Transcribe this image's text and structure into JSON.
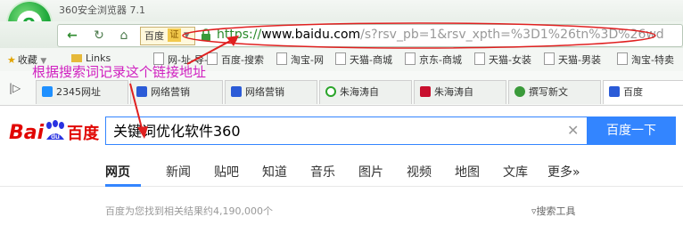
{
  "browser": {
    "title": "360安全浏览器 7.1",
    "engine_label": "百度",
    "cert_label": "证",
    "url_protocol": "https://",
    "url_domain": "www.baidu.com",
    "url_path": "/s?rsv_pb=1&rsv_xpth=%3D1%26tn%3D%26wd"
  },
  "bookmarks": [
    {
      "label": "收藏",
      "icon": "star-icon"
    },
    {
      "label": "Links",
      "icon": "folder-icon"
    },
    {
      "label": "网-址-导-航",
      "icon": "page-icon"
    },
    {
      "label": "百度-搜索",
      "icon": "page-icon"
    },
    {
      "label": "淘宝-网",
      "icon": "page-icon"
    },
    {
      "label": "天猫-商城",
      "icon": "page-icon"
    },
    {
      "label": "京东-商城",
      "icon": "page-icon"
    },
    {
      "label": "天猫-女装",
      "icon": "page-icon"
    },
    {
      "label": "天猫-男装",
      "icon": "page-icon"
    },
    {
      "label": "淘宝-特卖",
      "icon": "page-icon"
    }
  ],
  "tabs": [
    {
      "label": "2345网址",
      "color": "#1e90ff"
    },
    {
      "label": "网络营销",
      "color": "#2b5bd7"
    },
    {
      "label": "网络营销",
      "color": "#2b5bd7"
    },
    {
      "label": "朱海涛自",
      "color": "#2aa52a"
    },
    {
      "label": "朱海涛自",
      "color": "#c8102e"
    },
    {
      "label": "撰写新文",
      "color": "#3a9a3a"
    },
    {
      "label": "百度",
      "color": "#2b5bd7"
    }
  ],
  "baidu": {
    "logo_bai": "Bai",
    "logo_du": "du",
    "logo_zh": "百度",
    "query": "关键词优化软件360",
    "search_button": "百度一下",
    "nav": [
      "网页",
      "新闻",
      "贴吧",
      "知道",
      "音乐",
      "图片",
      "视频",
      "地图",
      "文库",
      "更多»"
    ],
    "result_count": "百度为您找到相关结果约4,190,000个",
    "search_tools": "搜索工具"
  },
  "annotation": {
    "text": "根据搜索词记录这个链接地址",
    "color": "#d020c0",
    "arrow_color": "#e02020"
  }
}
